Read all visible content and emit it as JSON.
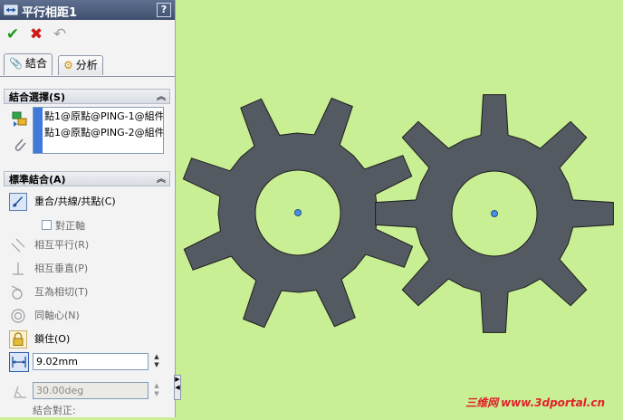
{
  "panel": {
    "title": "平行相距1",
    "help": "?",
    "actions": {
      "ok": "✔",
      "cancel": "✖",
      "undo": "↶"
    },
    "tabs": [
      {
        "label": "結合",
        "icon": "paperclip-icon",
        "active": true
      },
      {
        "label": "分析",
        "icon": "analysis-icon",
        "active": false
      }
    ],
    "selections": {
      "header": "結合選擇(S)",
      "items": [
        "點1@原點@PING-1@組件",
        "點1@原點@PING-2@組件"
      ]
    },
    "standard": {
      "header": "標準結合(A)",
      "coincident": "重合/共線/共點(C)",
      "align_axis": "對正軸",
      "parallel": "相互平行(R)",
      "perpendicular": "相互垂直(P)",
      "tangent": "互為相切(T)",
      "concentric": "同軸心(N)",
      "lock": "鎖住(O)",
      "distance_value": "9.02mm",
      "angle_value": "30.00deg",
      "alignment_label": "結合對正:"
    }
  },
  "viewport": {
    "background": "#c8ef94",
    "gear_color": "#545a62",
    "watermark": {
      "cn": "三维网",
      "url": "www.3dportal.cn"
    }
  }
}
